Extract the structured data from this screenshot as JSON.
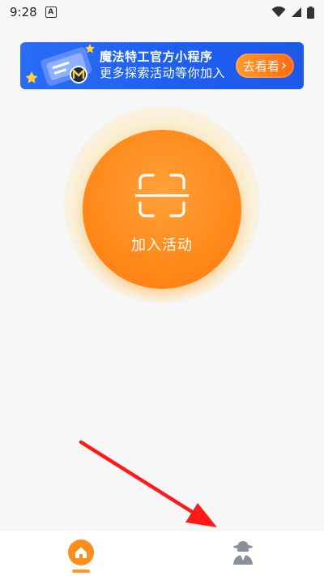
{
  "status_bar": {
    "time": "9:28",
    "notification_glyph": "A",
    "icons": [
      "wifi-icon",
      "signal-icon",
      "battery-icon"
    ]
  },
  "banner": {
    "title": "魔法特工官方小程序",
    "subtitle": "更多探索活动等你加入",
    "button_label": "去看看",
    "button_arrow": "›",
    "background_color": "#1e5ef0",
    "button_color": "#ff7a15"
  },
  "main": {
    "join_label": "加入活动",
    "icon": "scan-icon",
    "accent_color": "#ff8a1c"
  },
  "bottom_nav": {
    "items": [
      {
        "icon": "home-icon",
        "active": true
      },
      {
        "icon": "spy-agent-icon",
        "active": false
      }
    ]
  },
  "annotation": {
    "icon": "red-arrow-icon",
    "color": "#ff1a1a"
  }
}
